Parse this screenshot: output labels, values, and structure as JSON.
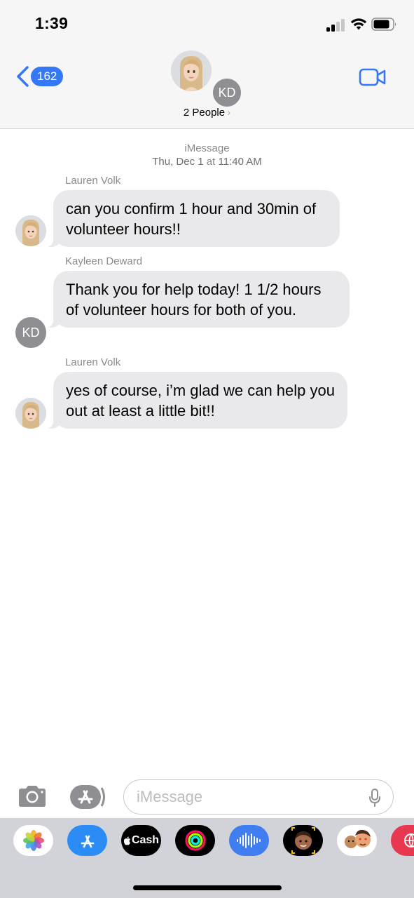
{
  "status_bar": {
    "time": "1:39"
  },
  "header": {
    "back_count": "162",
    "group_initials": "KD",
    "people_label": "2 People",
    "people_chevron": "›"
  },
  "conversation": {
    "service": "iMessage",
    "date_prefix": "Thu, Dec 1",
    "date_at": "at",
    "time": "11:40 AM",
    "messages": [
      {
        "sender": "Lauren Volk",
        "text": "can you confirm 1 hour and 30min of volunteer hours!!",
        "avatar": "memoji-blonde"
      },
      {
        "sender": "Kayleen Deward",
        "text": "Thank you for help today! 1 1/2 hours of volunteer hours for both of you.",
        "avatar_initials": "KD"
      },
      {
        "sender": "Lauren Volk",
        "text": "yes of course, i’m glad we can help you out at least a little bit!!",
        "avatar": "memoji-blonde"
      }
    ]
  },
  "compose": {
    "placeholder": "iMessage"
  },
  "drawer": {
    "apps": [
      "photos-icon",
      "app-store-icon",
      "apple-cash-icon",
      "activity-icon",
      "audio-message-icon",
      "memoji-icon",
      "memoji-stickers-icon",
      "browser-icon"
    ],
    "cash_label": "Cash"
  },
  "colors": {
    "accent": "#3478f6",
    "bubble": "#e9e9eb",
    "meta_text": "#8a8a8e"
  }
}
